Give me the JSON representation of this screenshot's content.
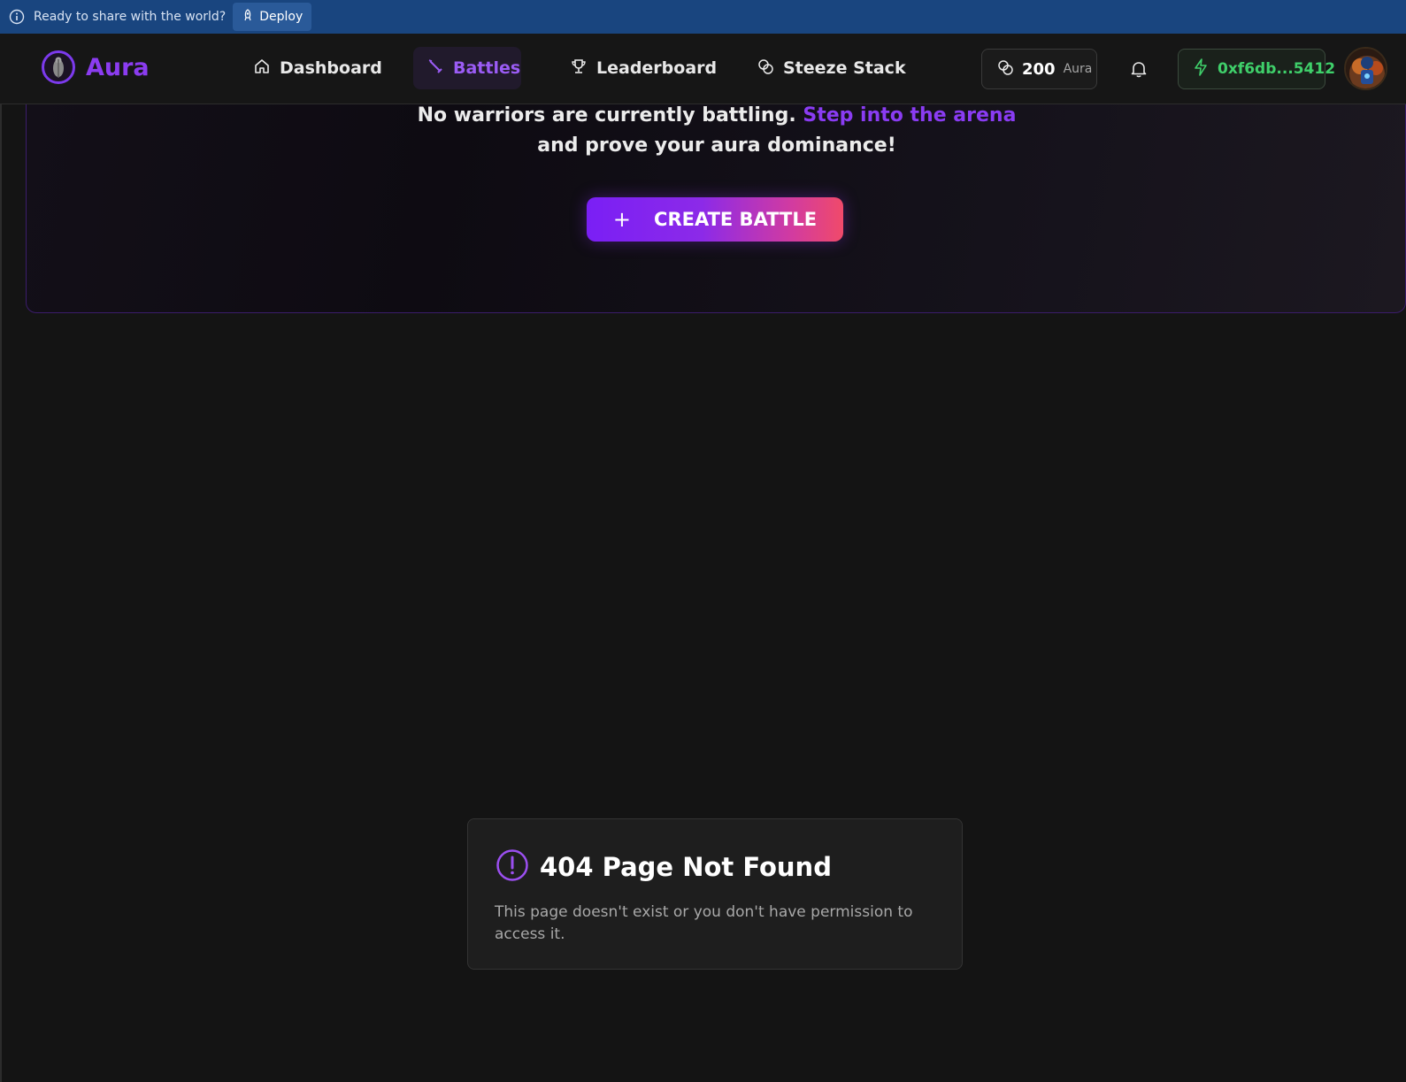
{
  "banner": {
    "text": "Ready to share with the world?",
    "deploy_label": "Deploy",
    "bg_color": "#19457f"
  },
  "navbar": {
    "brand": "Aura",
    "brand_color": "#8b3cf0",
    "items": [
      {
        "label": "Dashboard",
        "icon": "home-icon",
        "active": false
      },
      {
        "label": "Battles",
        "icon": "sword-icon",
        "active": true
      },
      {
        "label": "Leaderboard",
        "icon": "trophy-icon",
        "active": false
      },
      {
        "label": "Steeze Stack",
        "icon": "coins-icon",
        "active": false
      }
    ],
    "balance": {
      "amount": "200",
      "unit": "Aura"
    },
    "wallet": {
      "address": "0xf6db...5412",
      "color": "#3fcf6a"
    }
  },
  "hero": {
    "line1_text": "No warriors are currently battling.",
    "line1_accent": "Step into the arena",
    "line2_text": "and prove your aura dominance!",
    "create_button": {
      "icon": "+",
      "label": "CREATE BATTLE"
    }
  },
  "error_card": {
    "icon": "alert-circle-icon",
    "title": "404 Page Not Found",
    "message": "This page doesn't exist or you don't have permission to access it."
  }
}
